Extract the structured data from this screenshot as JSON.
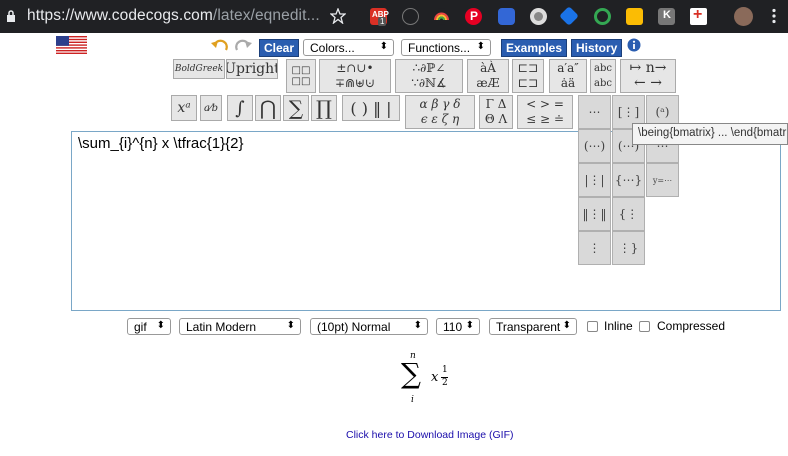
{
  "browser": {
    "url_main": "https://www.codecogs.com",
    "url_rest": "/latex/eqnedit...",
    "ext_badge": "1"
  },
  "toolbar": {
    "clear_label": "Clear",
    "colors_value": "Colors...",
    "functions_value": "Functions...",
    "examples_label": "Examples",
    "history_label": "History",
    "boldgreek_label": "BoldGreek",
    "upright_label": "Upright"
  },
  "editor": {
    "value": "\\sum_{i}^{n} x \\tfrac{1}{2}"
  },
  "tooltip": {
    "text": "\\being{bmatrix} ... \\end{bmatrix}"
  },
  "options": {
    "format": "gif",
    "font": "Latin Modern",
    "size": "(10pt) Normal",
    "dpi": "110",
    "background": "Transparent",
    "inline_label": "Inline",
    "compressed_label": "Compressed"
  },
  "preview": {
    "upper": "n",
    "lower": "i",
    "body_var": "x",
    "numerator": "1",
    "denominator": "2"
  },
  "download": {
    "link_text": "Click here to Download Image (GIF)"
  },
  "colors": {
    "button_blue": "#2a5db0",
    "browser_bar": "#202124",
    "link": "#1a0dab"
  }
}
